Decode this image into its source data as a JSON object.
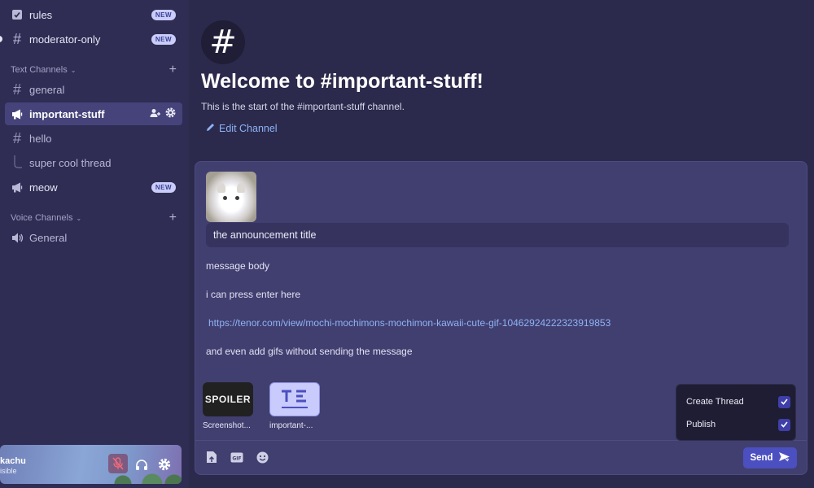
{
  "sidebar": {
    "channels_top": [
      {
        "label": "rules",
        "icon": "rules-checkbox-icon",
        "badge": "NEW"
      },
      {
        "label": "moderator-only",
        "icon": "hash-icon",
        "badge": "NEW"
      }
    ],
    "text_category": "Text Channels",
    "text_channels": [
      {
        "label": "general",
        "icon": "hash-icon"
      },
      {
        "label": "important-stuff",
        "icon": "announcement-megaphone-icon",
        "selected": true
      },
      {
        "label": "hello",
        "icon": "hash-icon"
      },
      {
        "label": "super cool thread",
        "icon": "thread-branch-icon"
      },
      {
        "label": "meow",
        "icon": "announcement-megaphone-icon",
        "badge": "NEW"
      }
    ],
    "voice_category": "Voice Channels",
    "voice_channels": [
      {
        "label": "General",
        "icon": "speaker-icon"
      }
    ],
    "user": {
      "name": "kachu",
      "status": "isible"
    }
  },
  "main": {
    "welcome_title": "Welcome to #important-stuff!",
    "start_text": "This is the start of the #important-stuff channel.",
    "edit_channel": "Edit Channel"
  },
  "composer": {
    "title_value": "the announcement title",
    "body_lines": [
      "message body",
      "i can press enter here",
      "https://tenor.com/view/mochi-mochimons-mochimon-kawaii-cute-gif-10462924222323919853",
      "and even add gifs without sending the message"
    ],
    "attachments": [
      {
        "label": "SPOILER",
        "name": "Screenshot..."
      },
      {
        "label": "",
        "name": "important-..."
      }
    ],
    "options": [
      {
        "label": "Create Thread",
        "checked": true
      },
      {
        "label": "Publish",
        "checked": true
      }
    ],
    "send_label": "Send"
  },
  "colors": {
    "accent": "#4c4fc0",
    "link": "#8fb2f5",
    "selected_channel": "#45437a",
    "badge_bg": "#c9cdf7"
  }
}
